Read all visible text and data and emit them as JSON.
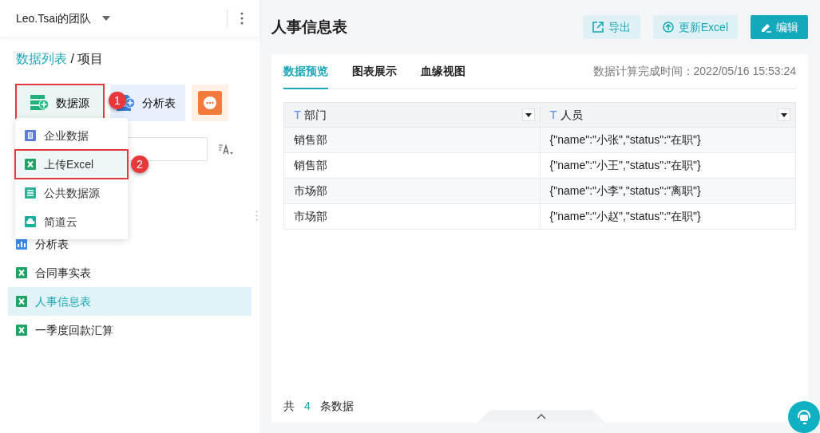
{
  "team": {
    "name": "Leo.Tsai的团队"
  },
  "breadcrumb": {
    "items": [
      {
        "label": "数据列表",
        "link": true
      },
      {
        "label": "项目",
        "link": false
      }
    ],
    "separator": "/"
  },
  "create_buttons": [
    {
      "kind": "datasource",
      "label": "数据源",
      "highlighted": true,
      "callout": "1"
    },
    {
      "kind": "analysis",
      "label": "分析表",
      "highlighted": false
    },
    {
      "kind": "more"
    }
  ],
  "dropdown": [
    {
      "kind": "enterprise",
      "label": "企业数据",
      "highlighted": false
    },
    {
      "kind": "excel",
      "label": "上传Excel",
      "highlighted": true,
      "callout": "2"
    },
    {
      "kind": "public",
      "label": "公共数据源",
      "highlighted": false
    },
    {
      "kind": "cloud",
      "label": "简道云",
      "highlighted": false
    }
  ],
  "items": [
    {
      "kind": "analysis",
      "label": "分析表",
      "selected": false
    },
    {
      "kind": "excel",
      "label": "合同事实表",
      "selected": false
    },
    {
      "kind": "excel",
      "label": "人事信息表",
      "selected": true
    },
    {
      "kind": "excel",
      "label": "一季度回款汇算",
      "selected": false
    }
  ],
  "main": {
    "title": "人事信息表",
    "actions": [
      {
        "kind": "export",
        "label": "导出",
        "primary": false
      },
      {
        "kind": "update",
        "label": "更新Excel",
        "primary": false
      },
      {
        "kind": "edit",
        "label": "编辑",
        "primary": true
      }
    ],
    "tabs": [
      {
        "label": "数据预览",
        "selected": true
      },
      {
        "label": "图表展示",
        "selected": false
      },
      {
        "label": "血缘视图",
        "selected": false
      }
    ],
    "computed_time": "数据计算完成时间：2022/05/16 15:53:24",
    "table": {
      "columns": [
        {
          "type_mark": "T",
          "label": "部门"
        },
        {
          "type_mark": "T",
          "label": "人员"
        }
      ],
      "rows": [
        [
          "销售部",
          "{\"name\":\"小张\",\"status\":\"在职\"}"
        ],
        [
          "销售部",
          "{\"name\":\"小王\",\"status\":\"在职\"}"
        ],
        [
          "市场部",
          "{\"name\":\"小李\",\"status\":\"离职\"}"
        ],
        [
          "市场部",
          "{\"name\":\"小赵\",\"status\":\"在职\"}"
        ]
      ]
    },
    "footer": {
      "prefix": "共",
      "count": "4",
      "suffix": "条数据"
    }
  }
}
